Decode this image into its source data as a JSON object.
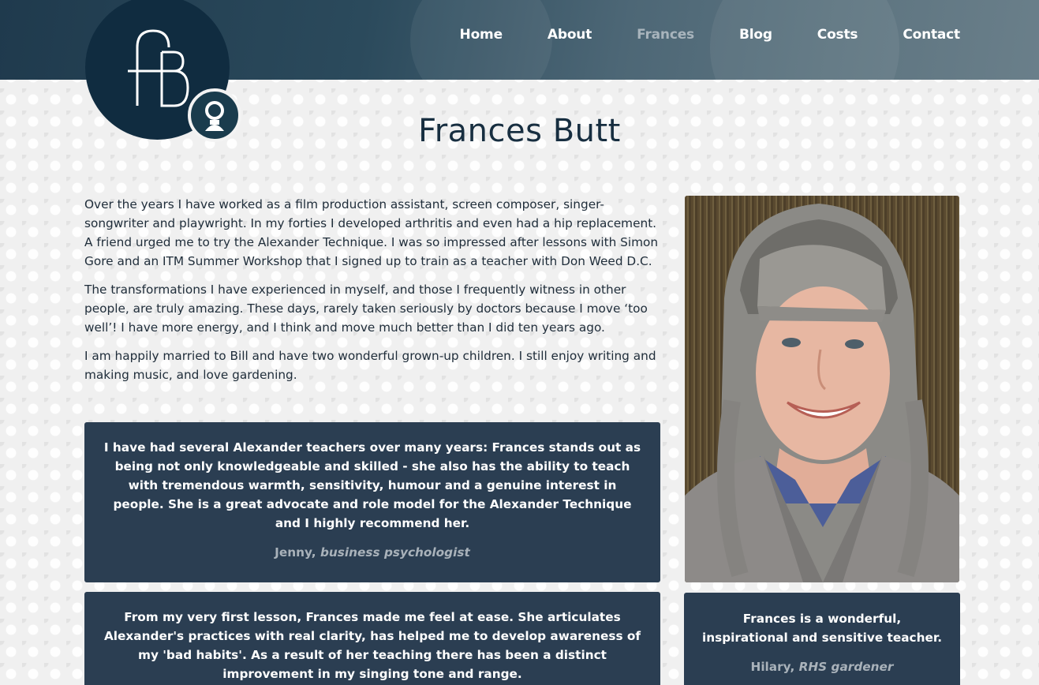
{
  "nav": {
    "items": [
      {
        "label": "Home"
      },
      {
        "label": "About"
      },
      {
        "label": "Frances"
      },
      {
        "label": "Blog"
      },
      {
        "label": "Costs"
      },
      {
        "label": "Contact"
      }
    ],
    "active": "Frances"
  },
  "logo": {
    "text": "fB"
  },
  "page": {
    "title": "Frances Butt"
  },
  "bio": {
    "paragraphs": [
      "Over the years I have worked as a film production assistant, screen composer, singer-songwriter and playwright.  In my forties I developed arthritis and even had a hip replacement.  A friend urged me to try the Alexander Technique.  I was so impressed after lessons with Simon Gore and an ITM Summer Workshop that I signed up to train as a teacher with Don Weed D.C.",
      "The transformations I have experienced in myself, and those I frequently witness in other people, are truly amazing.  These days, rarely taken seriously by doctors because I move ‘too well’!  I have more energy, and I think and move much better than I did ten years ago.",
      "I am happily married to Bill and have two wonderful grown-up children.  I still enjoy writing and making music, and love gardening."
    ]
  },
  "testimonials": [
    {
      "text": "I have had several Alexander teachers over many years: Frances stands out as being not only knowledgeable and skilled - she also has the ability to teach with tremendous warmth, sensitivity, humour and a genuine interest in people. She is a great advocate and role model for the Alexander Technique and I highly recommend her.",
      "name": "Jenny,",
      "role": "business psychologist"
    },
    {
      "text": "From my very first lesson, Frances made me feel at ease. She articulates Alexander's practices with real clarity, has helped me to develop awareness of my 'bad habits'. As a result of her teaching there has been a distinct improvement in my singing tone and range.",
      "name": "",
      "role": ""
    },
    {
      "text": "Frances is a wonderful, inspirational and sensitive teacher.",
      "name": "Hilary,",
      "role": "RHS gardener"
    }
  ],
  "colors": {
    "header": "#2b4a5c",
    "logo": "#102c40",
    "quote_bg": "#2b3e52",
    "title": "#172e40",
    "nav_active": "#a8b4bc"
  }
}
